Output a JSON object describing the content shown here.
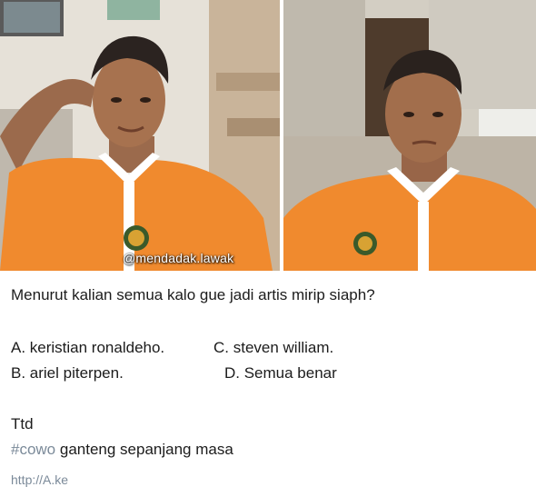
{
  "photo_left": {
    "alt": ""
  },
  "photo_right": {
    "alt": ""
  },
  "watermark": "@mendadak.lawak",
  "question": "Menurut kalian semua kalo gue jadi artis mirip siaph?",
  "options": {
    "a": "A. keristian ronaldeho.",
    "b": "B. ariel piterpen.",
    "c": "C. steven william.",
    "d": "D. Semua benar"
  },
  "signature": "Ttd",
  "tagline": {
    "hashtag": "#cowo",
    "rest": " ganteng sepanjang masa"
  },
  "link": "http://A.ke",
  "colors": {
    "shirt": "#f08a2e",
    "collar": "#ffffff",
    "hashtag": "#7b8a99"
  }
}
